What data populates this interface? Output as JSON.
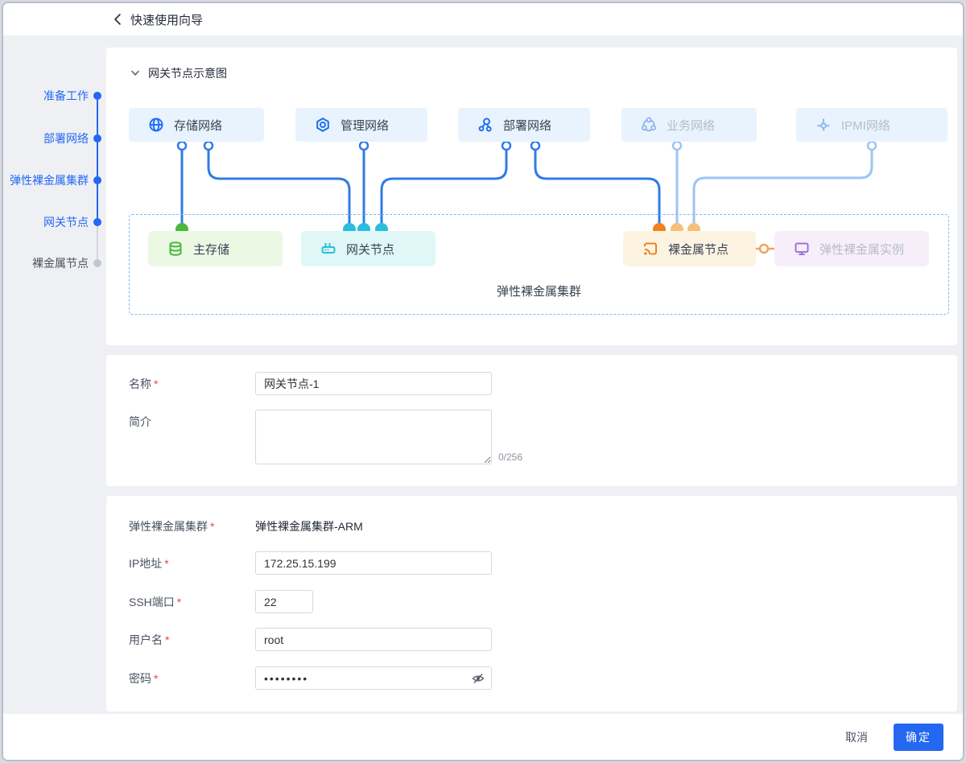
{
  "header": {
    "title": "快速使用向导"
  },
  "stepper": {
    "steps": [
      {
        "label": "准备工作",
        "state": "active"
      },
      {
        "label": "部署网络",
        "state": "active"
      },
      {
        "label": "弹性裸金属集群",
        "state": "active"
      },
      {
        "label": "网关节点",
        "state": "active"
      },
      {
        "label": "裸金属节点",
        "state": "pending"
      }
    ]
  },
  "diagram": {
    "title": "网关节点示意图",
    "cluster_label": "弹性裸金属集群",
    "networks": [
      {
        "label": "存储网络",
        "icon": "globe-icon",
        "state": "active"
      },
      {
        "label": "管理网络",
        "icon": "gear-hex-icon",
        "state": "active"
      },
      {
        "label": "部署网络",
        "icon": "nodes-icon",
        "state": "active"
      },
      {
        "label": "业务网络",
        "icon": "cycle-icon",
        "state": "inactive"
      },
      {
        "label": "IPMI网络",
        "icon": "axis-icon",
        "state": "inactive"
      }
    ],
    "nodes": [
      {
        "label": "主存储",
        "icon": "database-icon",
        "color": "green"
      },
      {
        "label": "网关节点",
        "icon": "router-icon",
        "color": "cyan"
      },
      {
        "label": "裸金属节点",
        "icon": "cast-icon",
        "color": "orange"
      },
      {
        "label": "弹性裸金属实例",
        "icon": "monitor-icon",
        "color": "purple"
      }
    ]
  },
  "form": {
    "name": {
      "label": "名称",
      "required": true,
      "value": "网关节点-1"
    },
    "description": {
      "label": "简介",
      "required": false,
      "value": "",
      "counter": "0/256"
    },
    "cluster": {
      "label": "弹性裸金属集群",
      "required": true,
      "value": "弹性裸金属集群-ARM"
    },
    "ip": {
      "label": "IP地址",
      "required": true,
      "value": "172.25.15.199"
    },
    "ssh_port": {
      "label": "SSH端口",
      "required": true,
      "value": "22"
    },
    "username": {
      "label": "用户名",
      "required": true,
      "value": "root"
    },
    "password": {
      "label": "密码",
      "required": true,
      "value": "••••••••"
    }
  },
  "footer": {
    "cancel_label": "取消",
    "confirm_label": "确定"
  },
  "colors": {
    "accent": "#2468f2",
    "wire_blue": "#2f7ce4",
    "wire_light_blue": "#9cc5f2",
    "storage_green": "#49b83c",
    "gateway_cyan": "#29bede",
    "baremetal_orange": "#f0811c",
    "baremetal_orange_light": "#f6bf7d",
    "instance_purple": "#a56fd6"
  }
}
